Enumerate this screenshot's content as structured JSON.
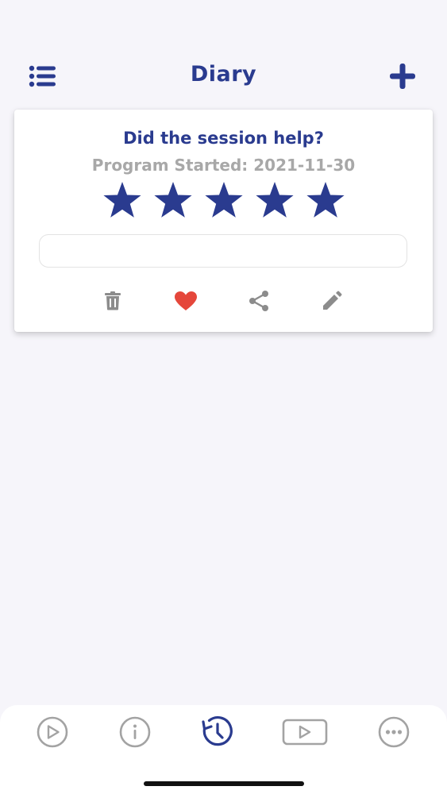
{
  "header": {
    "title": "Diary",
    "menu_icon": "list-icon",
    "add_icon": "plus-icon"
  },
  "entry": {
    "question": "Did the session help?",
    "program_started": "Program Started: 2021-11-30",
    "rating": 5,
    "rating_max": 5,
    "note_value": "",
    "actions": [
      "trash-icon",
      "heart-icon",
      "share-icon",
      "pencil-icon"
    ]
  },
  "tabs": [
    {
      "icon": "play-circle-icon",
      "active": false
    },
    {
      "icon": "info-circle-icon",
      "active": false
    },
    {
      "icon": "history-icon",
      "active": true
    },
    {
      "icon": "video-play-icon",
      "active": false
    },
    {
      "icon": "more-circle-icon",
      "active": false
    }
  ],
  "colors": {
    "primary": "#2a3b8f",
    "muted": "#a8a8a8",
    "icon_gray": "#8c8c8c",
    "heart": "#e5473b",
    "background": "#f6f5fa"
  }
}
